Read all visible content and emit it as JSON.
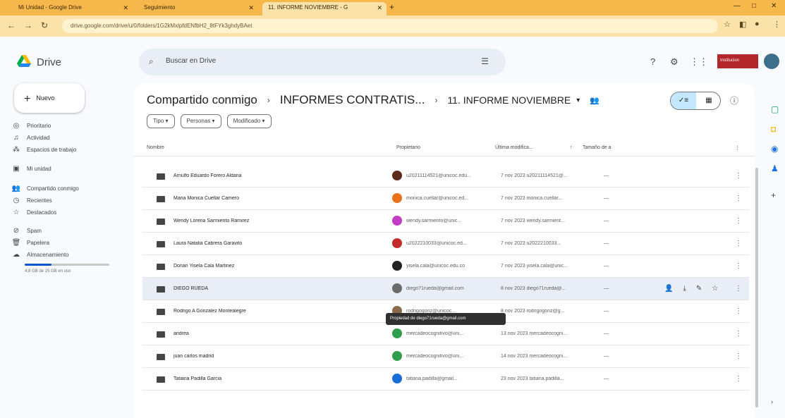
{
  "browser": {
    "tabs": [
      {
        "title": "Mi Unidad - Google Drive"
      },
      {
        "title": "Seguimiento"
      },
      {
        "title": "11. INFORME NOVIEMBRE - G"
      }
    ],
    "url": "drive.google.com/drive/u/0/folders/1G2kMxlpfdENfbH2_8tFYk3ghdyBAet"
  },
  "app": {
    "name": "Drive",
    "search_placeholder": "Buscar en Drive",
    "badge": "Institucion"
  },
  "sidebar": {
    "new_label": "Nuevo",
    "items": [
      {
        "label": "Prioritario",
        "icon": "priority-icon"
      },
      {
        "label": "Actividad",
        "icon": "activity-icon"
      },
      {
        "label": "Espacios de trabajo",
        "icon": "workspaces-icon"
      },
      {
        "label": "Mi unidad",
        "icon": "my-drive-icon"
      },
      {
        "label": "Compartido conmigo",
        "icon": "shared-icon"
      },
      {
        "label": "Recientes",
        "icon": "recent-icon"
      },
      {
        "label": "Destacados",
        "icon": "star-icon"
      },
      {
        "label": "Spam",
        "icon": "spam-icon"
      },
      {
        "label": "Papelera",
        "icon": "trash-icon"
      },
      {
        "label": "Almacenamiento",
        "icon": "cloud-icon"
      }
    ],
    "storage_text": "4,8 GB de 15 GB en uso",
    "storage_used_fraction": 0.32
  },
  "breadcrumb": {
    "root": "Compartido conmigo",
    "middle": "INFORMES CONTRATIS...",
    "current": "11. INFORME NOVIEMBRE"
  },
  "filters": [
    "Tipo",
    "Personas",
    "Modificado"
  ],
  "table": {
    "headers": {
      "name": "Nombre",
      "owner": "Propietario",
      "modified": "Última modifica...",
      "size": "Tamaño de a"
    },
    "rows": [
      {
        "name": "Arnulfo Eduardo Forero Aldana",
        "owner": "u20211114521@unicoc.edu...",
        "modified": "7 nov 2023 u20211114521@...",
        "size": "—",
        "avatar_color": "#5a2a1a"
      },
      {
        "name": "Maria Monica Cuellar Camero",
        "owner": "monica.cuellar@unicoc.ed...",
        "modified": "7 nov 2023 monica.cuellar...",
        "size": "—",
        "avatar_color": "#e8711a"
      },
      {
        "name": "Wendy Lorena Sarmiento Ramirez",
        "owner": "wendy.sarmiento@unic...",
        "modified": "7 nov 2023 wendy.sarmient...",
        "size": "—",
        "avatar_color": "#c43cc4"
      },
      {
        "name": "Laura Natalia Cabrera Garavito",
        "owner": "u2022210033@unicoc.ed...",
        "modified": "7 nov 2023 u2022210033...",
        "size": "—",
        "avatar_color": "#c42a2a"
      },
      {
        "name": "Dorian Yisela Cala Martinez",
        "owner": "yisela.cala@unicoc.edu.co",
        "modified": "7 nov 2023 yisela.cala@unic...",
        "size": "—",
        "avatar_color": "#222222"
      },
      {
        "name": "DIEGO RUEDA",
        "owner": "diego71rueda@gmail.com",
        "modified": "8 nov 2023 diego71rueda@...",
        "size": "—",
        "avatar_color": "#6b6b6b"
      },
      {
        "name": "Rodrigo A Gonzalez Montealegre",
        "owner": "rodrigogonz@unicoc...",
        "modified": "8 nov 2023 rodrigogonz@g...",
        "size": "—",
        "avatar_color": "#8a6a4a"
      },
      {
        "name": "andrea",
        "owner": "mercadeocognitivo@uni...",
        "modified": "13 nov 2023 mercadeocogni...",
        "size": "—",
        "avatar_color": "#2e9e4a"
      },
      {
        "name": "juan carlos madrid",
        "owner": "mercadeocognitivo@uni...",
        "modified": "14 nov 2023 mercadeocogni...",
        "size": "—",
        "avatar_color": "#2e9e4a"
      },
      {
        "name": "Tatiana Padilla Garcia",
        "owner": "tatiana.padilla@gmail...",
        "modified": "23 nov 2023 tatiana.padilla...",
        "size": "—",
        "avatar_color": "#1a6ed8"
      }
    ],
    "highlighted_index": 5
  },
  "tooltip": "Propiedad de diego71rueda@gmail.com",
  "colors": {
    "tabbar": "#f6b84b",
    "accent": "#0b57d0",
    "toggle_active": "#c2e7ff"
  }
}
